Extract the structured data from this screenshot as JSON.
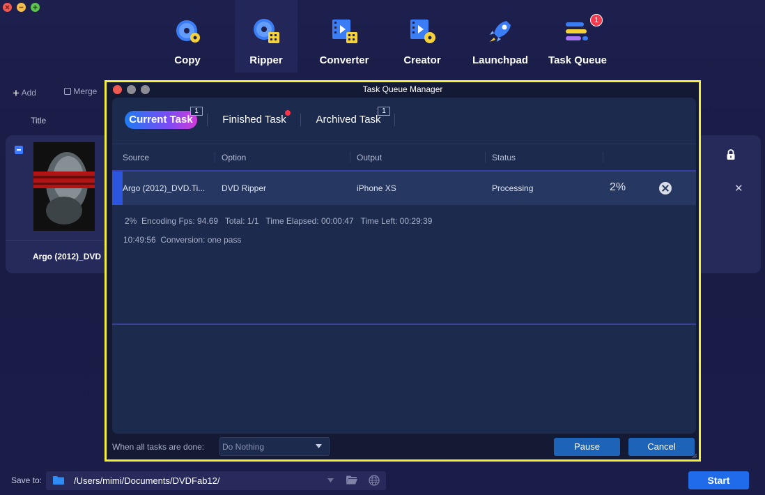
{
  "nav": {
    "items": [
      {
        "label": "Copy",
        "icon": "copy-disc-icon"
      },
      {
        "label": "Ripper",
        "icon": "ripper-disc-icon"
      },
      {
        "label": "Converter",
        "icon": "converter-film-icon"
      },
      {
        "label": "Creator",
        "icon": "creator-film-icon"
      },
      {
        "label": "Launchpad",
        "icon": "rocket-icon"
      },
      {
        "label": "Task Queue",
        "icon": "task-queue-icon"
      }
    ],
    "active": "Ripper",
    "task_queue_badge": "1"
  },
  "main": {
    "add_label": "Add",
    "merge_label": "Merge",
    "column_title": "Title",
    "title_name": "Argo (2012)_DVD"
  },
  "modal": {
    "title": "Task Queue Manager",
    "tabs": {
      "current": {
        "label": "Current Task",
        "count": "1"
      },
      "finished": {
        "label": "Finished Task"
      },
      "archived": {
        "label": "Archived Task",
        "count": "1"
      }
    },
    "columns": {
      "source": "Source",
      "option": "Option",
      "output": "Output",
      "status": "Status"
    },
    "row": {
      "source": "Argo (2012)_DVD.Ti...",
      "option": "DVD Ripper",
      "output": "iPhone XS",
      "status": "Processing",
      "percent": "2%"
    },
    "details": {
      "line1": "2%  Encoding Fps: 94.69   Total: 1/1   Time Elapsed: 00:00:47   Time Left: 00:29:39",
      "line2": "10:49:56  Conversion: one pass"
    },
    "footer": {
      "label": "When all tasks are done:",
      "select_value": "Do Nothing",
      "pause_label": "Pause",
      "cancel_label": "Cancel"
    }
  },
  "bottom": {
    "save_to_label": "Save to:",
    "path": "/Users/mimi/Documents/DVDFab12/",
    "start_label": "Start"
  },
  "colors": {
    "accent": "#1f6bea",
    "highlight_border": "#f5ee3a",
    "badge": "#f33a4e"
  }
}
